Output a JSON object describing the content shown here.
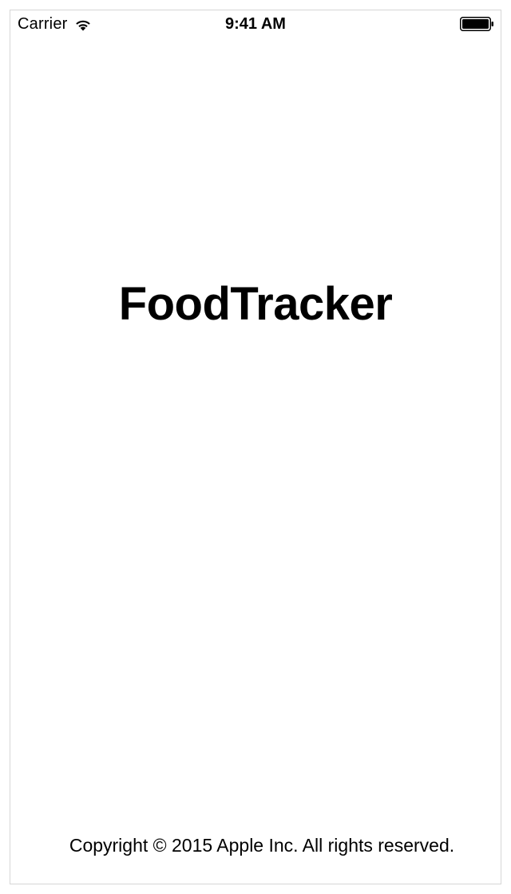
{
  "status_bar": {
    "carrier": "Carrier",
    "time": "9:41 AM",
    "wifi_icon": "wifi-icon",
    "battery_icon": "battery-full-icon"
  },
  "main": {
    "title": "FoodTracker"
  },
  "footer": {
    "copyright": "Copyright © 2015 Apple Inc. All rights reserved."
  }
}
